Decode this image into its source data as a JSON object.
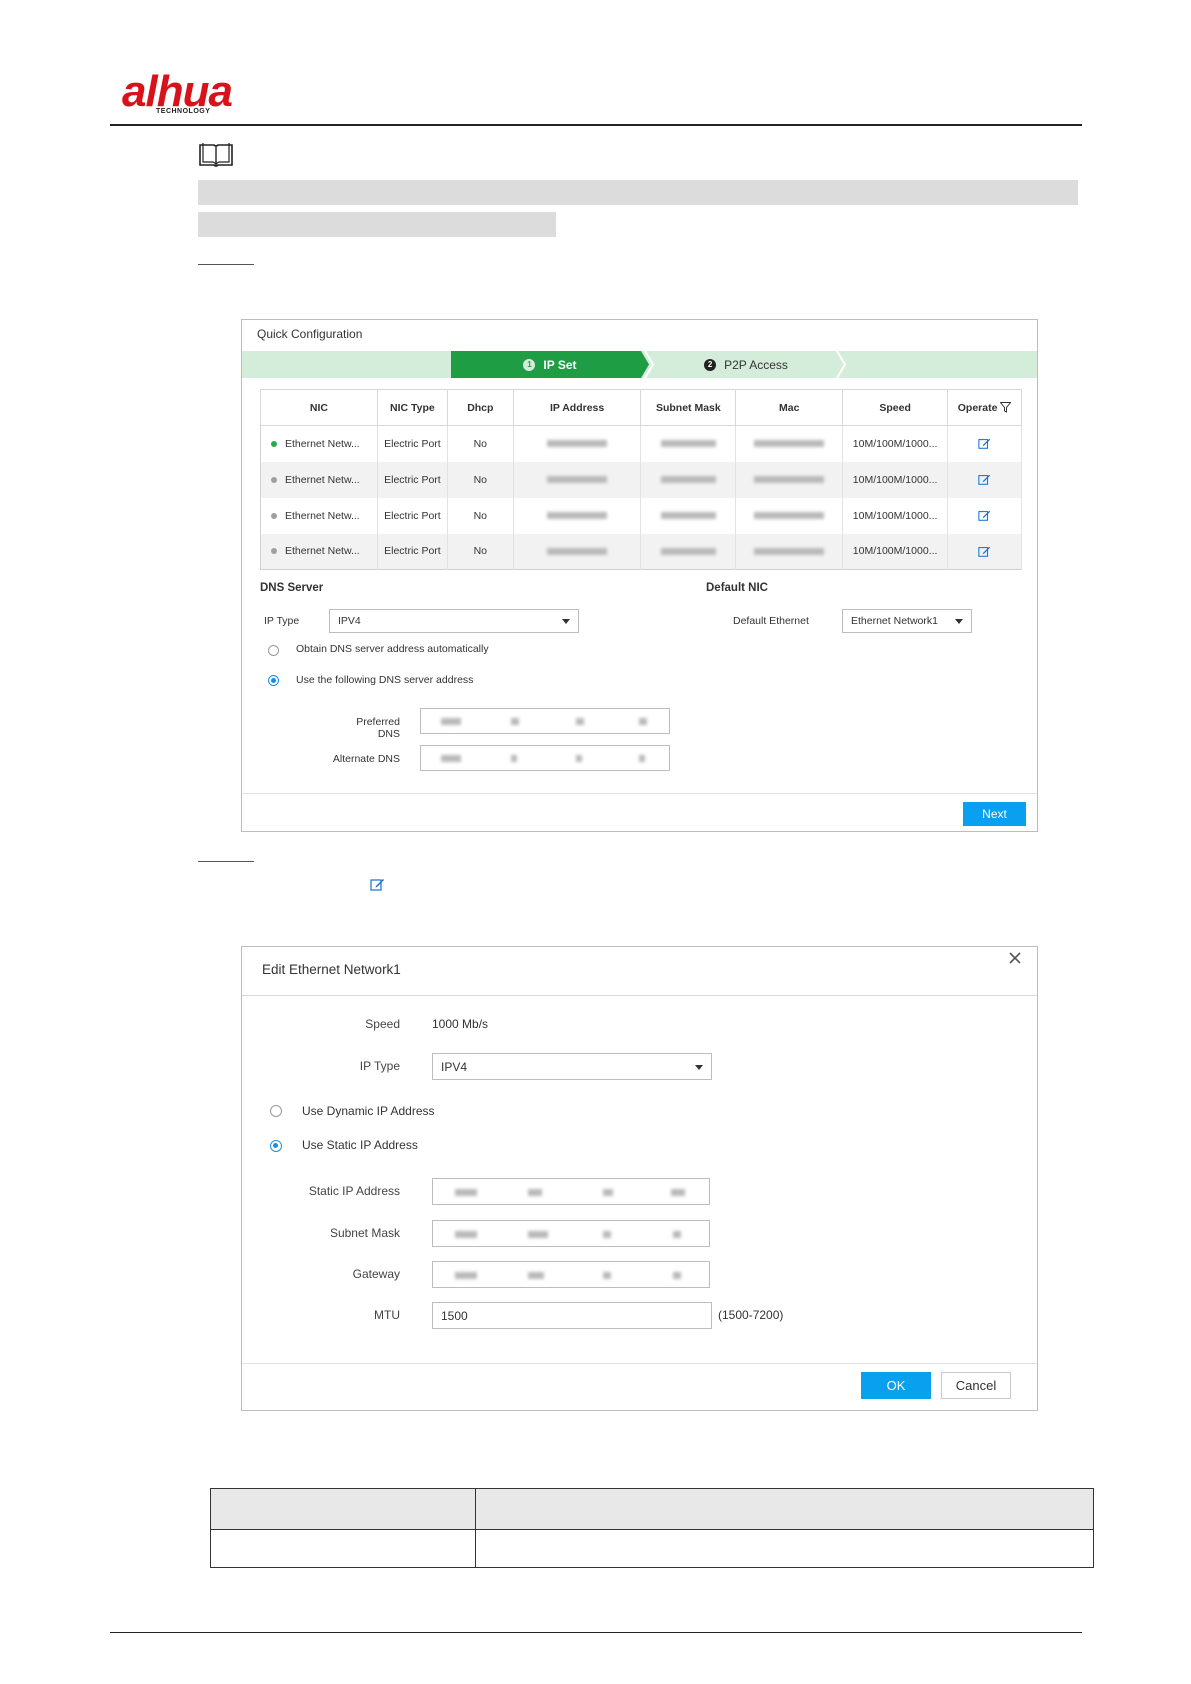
{
  "header": {
    "logo_text": "alhua",
    "logo_sub": "TECHNOLOGY"
  },
  "quick_config": {
    "title": "Quick Configuration",
    "steps": [
      {
        "num": "1",
        "label": "IP Set",
        "active": true
      },
      {
        "num": "2",
        "label": "P2P Access",
        "active": false
      }
    ],
    "table": {
      "columns": [
        "NIC",
        "NIC Type",
        "Dhcp",
        "IP Address",
        "Subnet Mask",
        "Mac",
        "Speed",
        "Operate"
      ],
      "rows": [
        {
          "nic": "Ethernet Netw...",
          "type": "Electric Port",
          "dhcp": "No",
          "speed": "10M/100M/1000...",
          "status_color": "#2aa84a"
        },
        {
          "nic": "Ethernet Netw...",
          "type": "Electric Port",
          "dhcp": "No",
          "speed": "10M/100M/1000...",
          "status_color": "#a0a0a0"
        },
        {
          "nic": "Ethernet Netw...",
          "type": "Electric Port",
          "dhcp": "No",
          "speed": "10M/100M/1000...",
          "status_color": "#a0a0a0"
        },
        {
          "nic": "Ethernet Netw...",
          "type": "Electric Port",
          "dhcp": "No",
          "speed": "10M/100M/1000...",
          "status_color": "#a0a0a0"
        }
      ]
    },
    "dns": {
      "heading": "DNS Server",
      "ip_type_label": "IP Type",
      "ip_type_value": "IPV4",
      "obtain_auto_label": "Obtain DNS server address automatically",
      "use_following_label": "Use the following DNS server address",
      "preferred_label": "Preferred DNS",
      "alternate_label": "Alternate DNS"
    },
    "default_nic": {
      "heading": "Default NIC",
      "default_ethernet_label": "Default Ethernet",
      "default_ethernet_value": "Ethernet Network1"
    },
    "next_label": "Next"
  },
  "edit_dialog": {
    "title": "Edit Ethernet Network1",
    "speed_label": "Speed",
    "speed_value": "1000 Mb/s",
    "ip_type_label": "IP Type",
    "ip_type_value": "IPV4",
    "dynamic_label": "Use Dynamic IP Address",
    "static_label": "Use Static IP Address",
    "static_ip_label": "Static IP Address",
    "subnet_label": "Subnet Mask",
    "gateway_label": "Gateway",
    "mtu_label": "MTU",
    "mtu_value": "1500",
    "mtu_range": "(1500-7200)",
    "ok_label": "OK",
    "cancel_label": "Cancel"
  },
  "colors": {
    "accent_blue": "#0aa0f0",
    "step_green": "#1f9d45",
    "brand_red": "#d8121a"
  }
}
